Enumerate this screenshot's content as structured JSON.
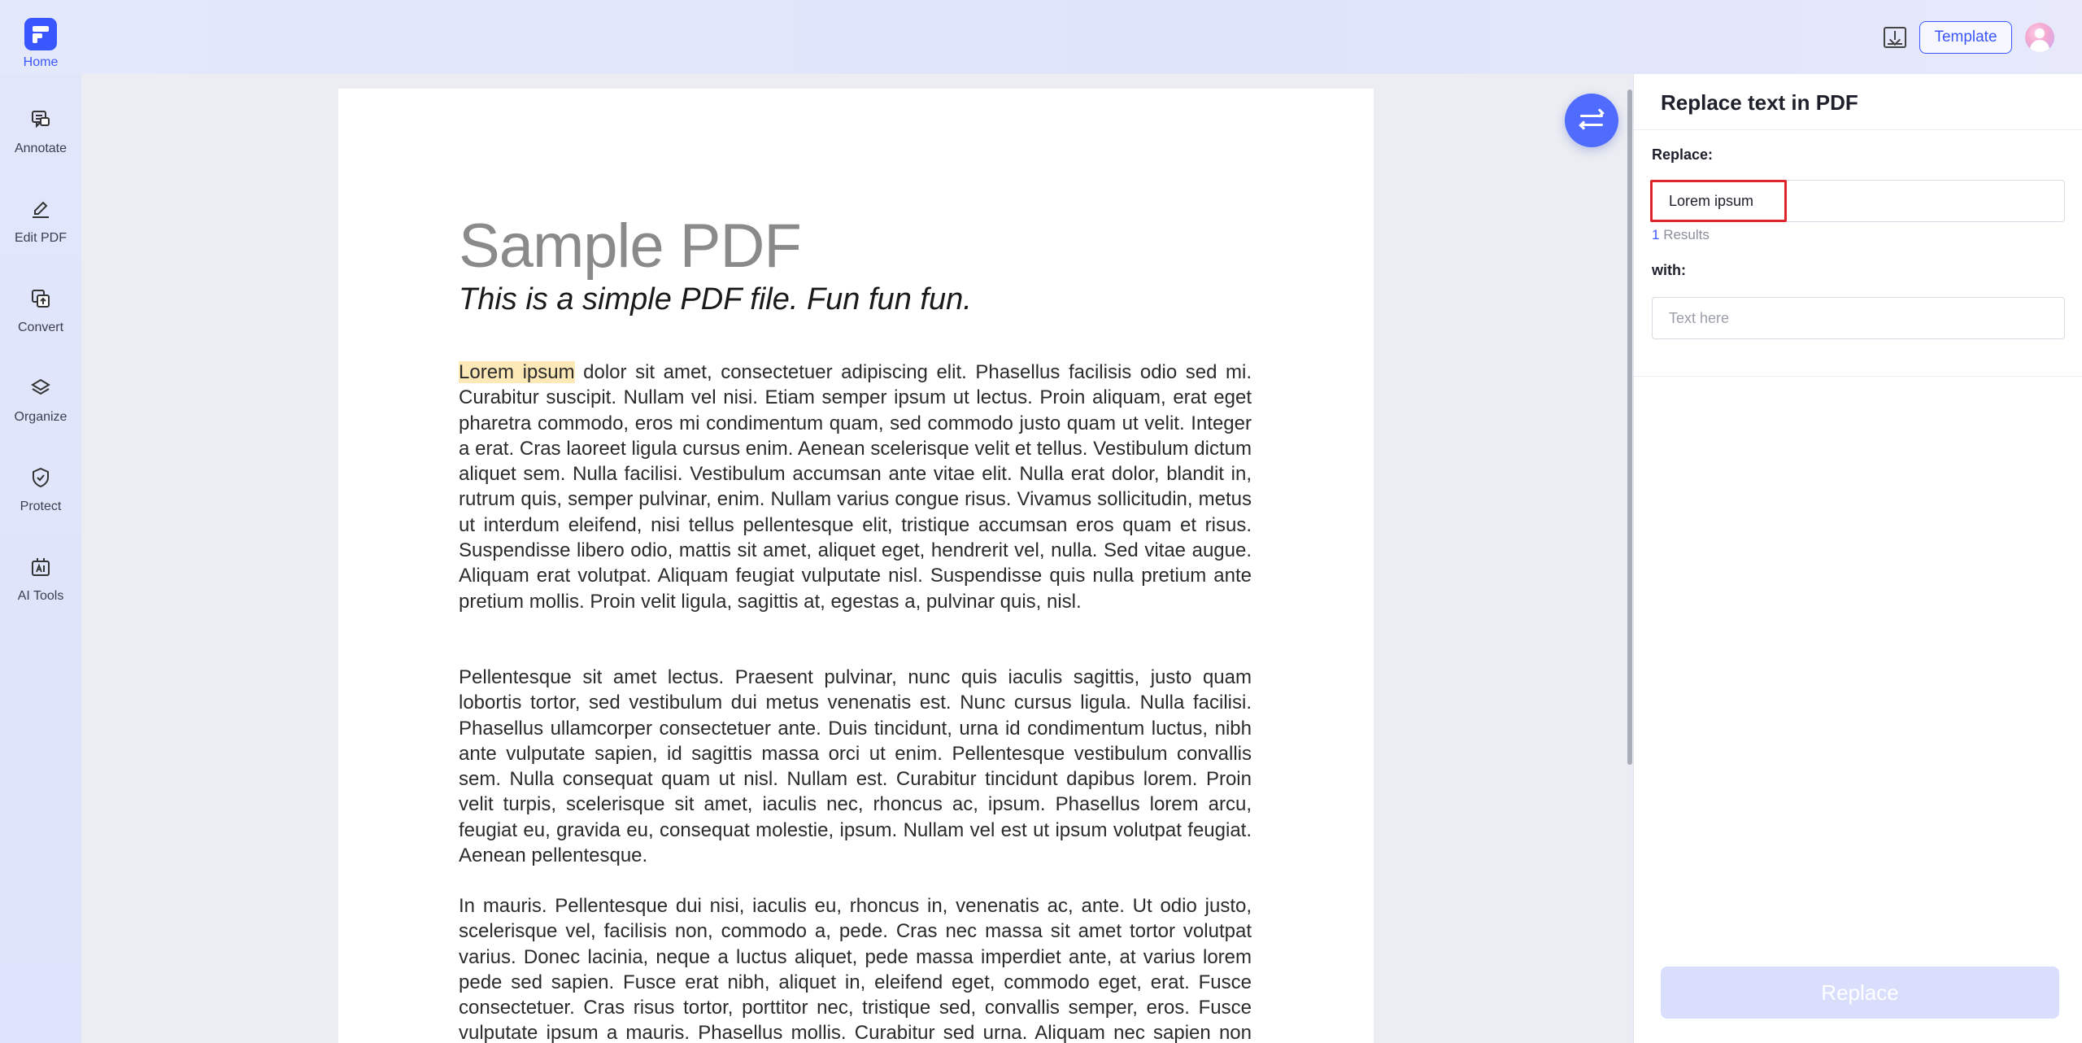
{
  "topbar": {
    "home_label": "Home",
    "template_label": "Template",
    "download_icon": "download-icon",
    "avatar_icon": "user-avatar"
  },
  "sidebar": {
    "items": [
      {
        "label": "Annotate",
        "icon": "annotate-icon"
      },
      {
        "label": "Edit PDF",
        "icon": "edit-pdf-icon"
      },
      {
        "label": "Convert",
        "icon": "convert-icon"
      },
      {
        "label": "Organize",
        "icon": "organize-icon"
      },
      {
        "label": "Protect",
        "icon": "protect-icon"
      },
      {
        "label": "AI Tools",
        "icon": "ai-tools-icon"
      }
    ]
  },
  "document": {
    "title": "Sample PDF",
    "subtitle": "This is a simple PDF file. Fun fun fun.",
    "highlight": "Lorem ipsum",
    "p1_rest": " dolor sit amet, consectetuer adipiscing elit. Phasellus facilisis odio sed mi. Curabitur suscipit. Nullam vel nisi. Etiam semper ipsum ut lectus. Proin aliquam, erat eget pharetra commodo, eros mi condimentum quam, sed commodo justo quam ut velit. Integer a erat. Cras laoreet ligula cursus enim. Aenean scelerisque velit et tellus. Vestibulum dictum aliquet sem. Nulla facilisi. Vestibulum accumsan ante vitae elit. Nulla erat dolor, blandit in, rutrum quis, semper pulvinar, enim. Nullam varius congue risus. Vivamus sollicitudin, metus ut interdum eleifend, nisi tellus pellentesque elit, tristique accumsan eros quam et risus. Suspendisse libero odio, mattis sit amet, aliquet eget, hendrerit vel, nulla. Sed vitae augue. Aliquam erat volutpat. Aliquam feugiat vulputate nisl. Suspendisse quis nulla pretium ante pretium mollis. Proin velit ligula, sagittis at, egestas a, pulvinar quis, nisl.",
    "p2": "Pellentesque sit amet lectus. Praesent pulvinar, nunc quis iaculis sagittis, justo quam lobortis tortor, sed vestibulum dui metus venenatis est. Nunc cursus ligula. Nulla facilisi. Phasellus ullamcorper consectetuer ante. Duis tincidunt, urna id condimentum luctus, nibh ante vulputate sapien, id sagittis massa orci ut enim. Pellentesque vestibulum convallis sem. Nulla consequat quam ut nisl. Nullam est. Curabitur tincidunt dapibus lorem. Proin velit turpis, scelerisque sit amet, iaculis nec, rhoncus ac, ipsum. Phasellus lorem arcu, feugiat eu, gravida eu, consequat molestie, ipsum. Nullam vel est ut ipsum volutpat feugiat. Aenean pellentesque.",
    "p3": "In mauris. Pellentesque dui nisi, iaculis eu, rhoncus in, venenatis ac, ante. Ut odio justo, scelerisque vel, facilisis non, commodo a, pede. Cras nec massa sit amet tortor volutpat varius. Donec lacinia, neque a luctus aliquet, pede massa imperdiet ante, at varius lorem pede sed sapien. Fusce erat nibh, aliquet in, eleifend eget, commodo eget, erat. Fusce consectetuer. Cras risus tortor, porttitor nec, tristique sed, convallis semper, eros. Fusce vulputate ipsum a mauris. Phasellus mollis. Curabitur sed urna. Aliquam nec sapien non nibh pulvinar convallis. Vivamus facilisis augue quis quam. Proin cursus aliquet metus."
  },
  "panel": {
    "title": "Replace text in PDF",
    "replace_label": "Replace:",
    "replace_value": "Lorem ipsum",
    "results_count": "1",
    "results_label": " Results",
    "with_label": "with:",
    "with_placeholder": "Text here",
    "replace_button": "Replace"
  },
  "colors": {
    "accent": "#3a56ff",
    "highlight": "#fde8b7",
    "selection_box": "#e0252a",
    "button_disabled": "#d9defd"
  }
}
